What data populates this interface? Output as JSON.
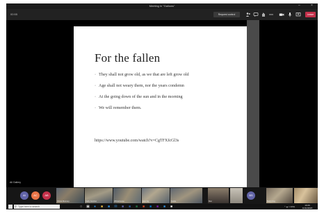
{
  "window": {
    "title": "Meeting in \"Gallows\""
  },
  "window_controls": {
    "minimize": "–",
    "close": "×"
  },
  "toolbar": {
    "timer": "00:55",
    "request_control_label": "Request control",
    "icons": [
      "people-icon",
      "chat-icon",
      "hand-icon",
      "more-icon",
      "camera-icon",
      "mic-icon",
      "share-icon"
    ],
    "leave_label": "Leave"
  },
  "slide": {
    "title": "For the fallen",
    "bullets": [
      "They shall not grow old, as we that are left grow old",
      "Age shall not weary them, nor the years condemn",
      "At the going down of the sun and in the morning",
      "We will remember them."
    ],
    "link": "https://www.youtube.com/watch?v=CgTFXfcGl3s"
  },
  "presenter_label": "Ali Gallery",
  "participants": {
    "avatars": [
      {
        "initials": "AI",
        "color": "#6264a7"
      },
      {
        "initials": "AC",
        "color": "#e97548"
      },
      {
        "initials": "AB",
        "color": "#c4314b"
      }
    ],
    "tile_labels": [
      "Olivia Mooney",
      "Kelly Gordon",
      "Whitehouse",
      "Eve Ng",
      "Kettle",
      "Mai",
      "Beth Ong"
    ],
    "right_avatar": {
      "initials": "BS",
      "color": "#6264a7"
    }
  },
  "taskbar": {
    "search_placeholder": "Type here to search",
    "apps": [
      "task-view-icon",
      "edge-icon",
      "explorer-icon",
      "store-icon",
      "mail-icon",
      "teams-icon",
      "word-icon",
      "excel-icon",
      "powerpoint-icon",
      "outlook-icon",
      "onenote-icon",
      "photos-icon"
    ],
    "tray": "^ ☁ □ ENG",
    "time": "10:26",
    "date": "11/11/2020"
  }
}
